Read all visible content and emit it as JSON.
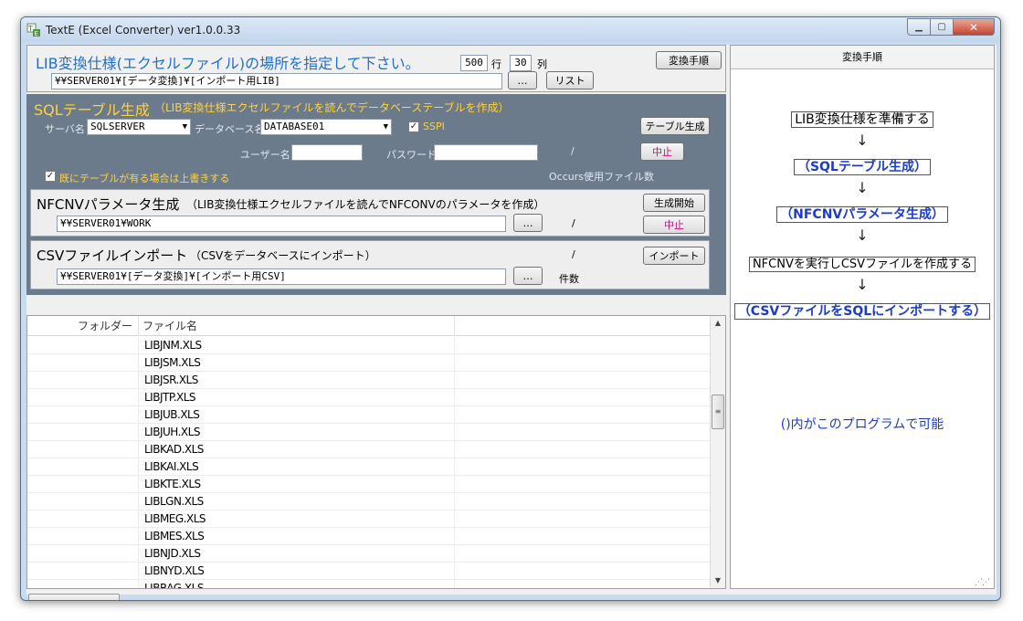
{
  "window": {
    "title": "TextE (Excel Converter) ver1.0.0.33"
  },
  "lib": {
    "heading": "LIB変換仕様(エクセルファイル)の場所を指定して下さい。",
    "rows_value": "500",
    "rows_label": "行",
    "cols_value": "30",
    "cols_label": "列",
    "path": "¥¥SERVER01¥[データ変換]¥[インポート用LIB]",
    "browse_label": "…",
    "list_button": "リスト",
    "procedure_button": "変換手順"
  },
  "sql": {
    "heading": "SQLテーブル生成",
    "description": "（LIB変換仕様エクセルファイルを読んでデータベーステーブルを作成）",
    "server_label": "サーバ名",
    "server_value": "SQLSERVER",
    "database_label": "データベース名",
    "database_value": "DATABASE01",
    "sspi_label": "SSPI",
    "create_button": "テーブル生成",
    "user_label": "ユーザー名",
    "password_label": "パスワード",
    "slash": "/",
    "stop_button": "中止",
    "overwrite_label": "既にテーブルが有る場合は上書きする",
    "occurs_label": "Occurs使用ファイル数"
  },
  "nfcnv": {
    "heading": "NFCNVパラメータ生成",
    "description": "（LIB変換仕様エクセルファイルを読んでNFCONVのパラメータを作成）",
    "path": "¥¥SERVER01¥WORK",
    "browse_label": "…",
    "slash": "/",
    "start_button": "生成開始",
    "stop_button": "中止"
  },
  "csv": {
    "heading": "CSVファイルインポート",
    "description": "（CSVをデータベースにインポート）",
    "path": "¥¥SERVER01¥[データ変換]¥[インポート用CSV]",
    "browse_label": "…",
    "slash": "/",
    "count_label": "件数",
    "import_button": "インポート"
  },
  "file_list": {
    "columns": [
      "フォルダー",
      "ファイル名"
    ],
    "files": [
      "LIBJNM.XLS",
      "LIBJSM.XLS",
      "LIBJSR.XLS",
      "LIBJTP.XLS",
      "LIBJUB.XLS",
      "LIBJUH.XLS",
      "LIBKAD.XLS",
      "LIBKAI.XLS",
      "LIBKTE.XLS",
      "LIBLGN.XLS",
      "LIBMEG.XLS",
      "LIBMES.XLS",
      "LIBNJD.XLS",
      "LIBNYD.XLS",
      "LIBRAG.XLS"
    ]
  },
  "procedure": {
    "header": "変換手順",
    "steps": [
      "LIB変換仕様を準備する",
      "（SQLテーブル生成）",
      "（NFCNVパラメータ生成）",
      "NFCNVを実行しCSVファイルを作成する",
      "（CSVファイルをSQLにインポートする）"
    ],
    "arrow": "↓",
    "note": "()内がこのプログラムで可能"
  },
  "colors": {
    "accent_blue": "#1f6fd0",
    "panel_gray": "#6b7b8c",
    "heading_yellow": "#ffd23f",
    "step_blue": "#1a3cc8"
  }
}
